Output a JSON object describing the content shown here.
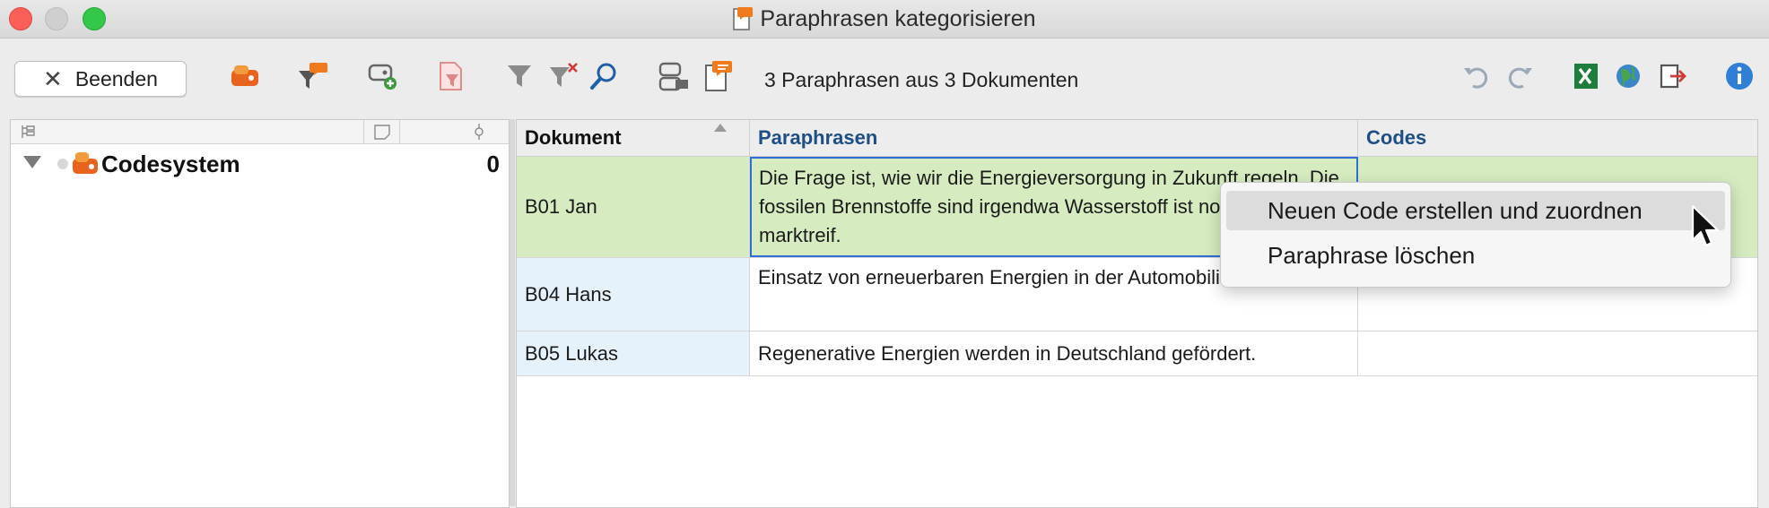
{
  "window": {
    "title": "Paraphrasen kategorisieren",
    "title_icon": "paraphrase-document-icon"
  },
  "toolbar": {
    "quit_label": "Beenden",
    "status": "3 Paraphrasen aus 3 Dokumenten",
    "icons": [
      "code-icon",
      "filter-paraphrase-icon",
      "new-code-icon",
      "filter-document-icon",
      "filter-icon",
      "clear-filter-icon",
      "search-icon",
      "code-settings-icon",
      "paraphrase-icon",
      "undo-icon",
      "redo-icon",
      "excel-export-icon",
      "web-export-icon",
      "export-icon",
      "info-icon"
    ]
  },
  "code_tree": {
    "root_label": "Codesystem",
    "root_count": "0"
  },
  "table": {
    "columns": [
      "Dokument",
      "Paraphrasen",
      "Codes"
    ],
    "rows": [
      {
        "document": "B01 Jan",
        "paraphrase": "Die Frage ist, wie wir die Energieversorgung in Zukunft regeln. Die fossilen Brennstoffe sind irgendwa Wasserstoff ist noch nicht marktreif.",
        "codes": ""
      },
      {
        "document": "B04 Hans",
        "paraphrase": "Einsatz von erneuerbaren Energien in der Automobilindustrie.",
        "codes": ""
      },
      {
        "document": "B05 Lukas",
        "paraphrase": "Regenerative Energien werden in Deutschland gefördert.",
        "codes": ""
      }
    ]
  },
  "context_menu": {
    "items": [
      "Neuen Code erstellen und zuordnen",
      "Paraphrase löschen"
    ]
  },
  "colors": {
    "selected_row": "#d6ecc0",
    "header_accent": "#1f4e86",
    "code_orange": "#e8641e"
  }
}
